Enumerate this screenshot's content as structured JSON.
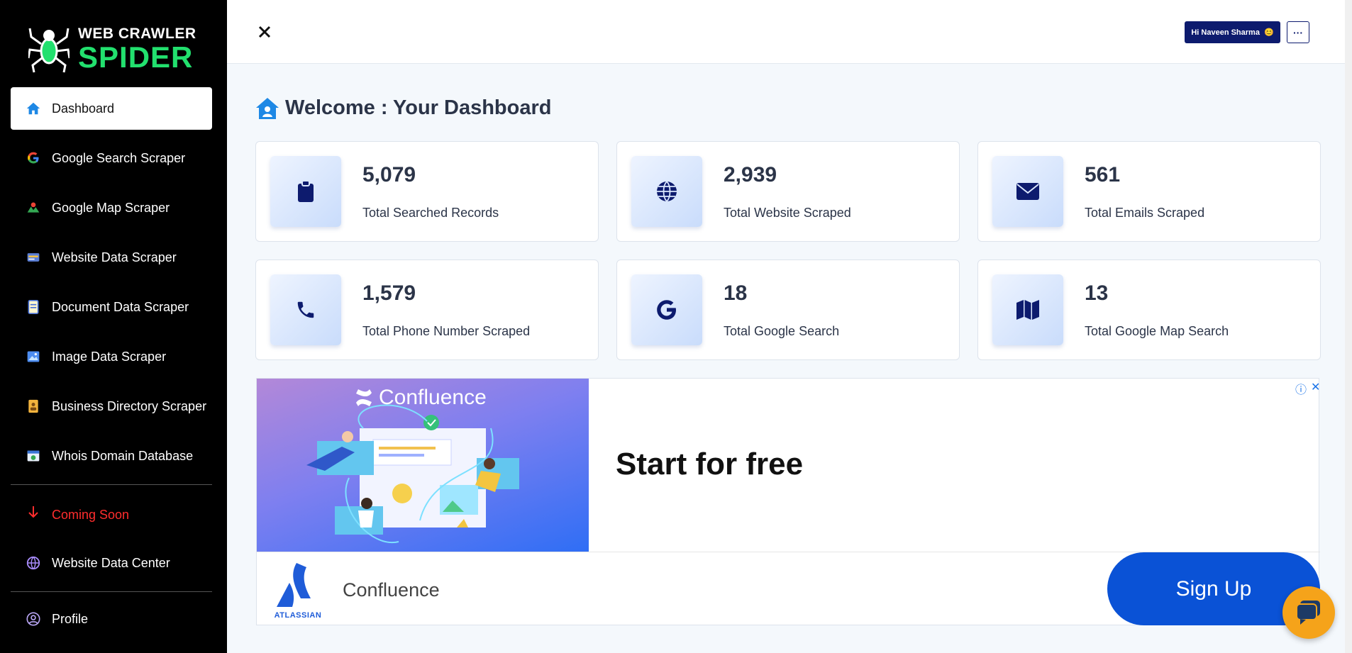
{
  "logo": {
    "line1": "WEB CRAWLER",
    "line2": "SPIDER",
    "accent": "#22e06e"
  },
  "sidebar": {
    "items": [
      {
        "label": "Dashboard",
        "icon": "home-icon",
        "active": true
      },
      {
        "label": "Google Search Scraper",
        "icon": "google-icon"
      },
      {
        "label": "Google Map Scraper",
        "icon": "map-pin-icon"
      },
      {
        "label": "Website Data Scraper",
        "icon": "browser-icon"
      },
      {
        "label": "Document Data Scraper",
        "icon": "document-icon"
      },
      {
        "label": "Image Data Scraper",
        "icon": "image-icon"
      },
      {
        "label": "Business Directory Scraper",
        "icon": "directory-icon"
      },
      {
        "label": "Whois Domain Database",
        "icon": "domain-icon"
      }
    ],
    "coming_soon": "Coming Soon",
    "data_center": "Website Data Center",
    "profile": "Profile"
  },
  "header": {
    "user_greeting": "Hi Naveen Sharma",
    "user_emoji": "😊",
    "more_label": "···"
  },
  "page": {
    "title": "Welcome : Your Dashboard"
  },
  "stats": [
    {
      "value": "5,079",
      "label": "Total Searched Records",
      "icon": "clipboard-icon"
    },
    {
      "value": "2,939",
      "label": "Total Website Scraped",
      "icon": "globe-icon"
    },
    {
      "value": "561",
      "label": "Total Emails Scraped",
      "icon": "envelope-icon"
    },
    {
      "value": "1,579",
      "label": "Total Phone Number Scraped",
      "icon": "phone-icon"
    },
    {
      "value": "18",
      "label": "Total Google Search",
      "icon": "google-g-icon"
    },
    {
      "value": "13",
      "label": "Total Google Map Search",
      "icon": "map-icon"
    }
  ],
  "ad": {
    "brand_top": "Confluence",
    "headline": "Start for free",
    "publisher": "ATLASSIAN",
    "name": "Confluence",
    "cta": "Sign Up",
    "info": "ⓘ",
    "close": "✕"
  },
  "colors": {
    "nav_dark": "#0d1b6e",
    "icon_blue": "#0d2a8a",
    "danger": "#ff2d2d",
    "chat": "#f5a31a"
  }
}
